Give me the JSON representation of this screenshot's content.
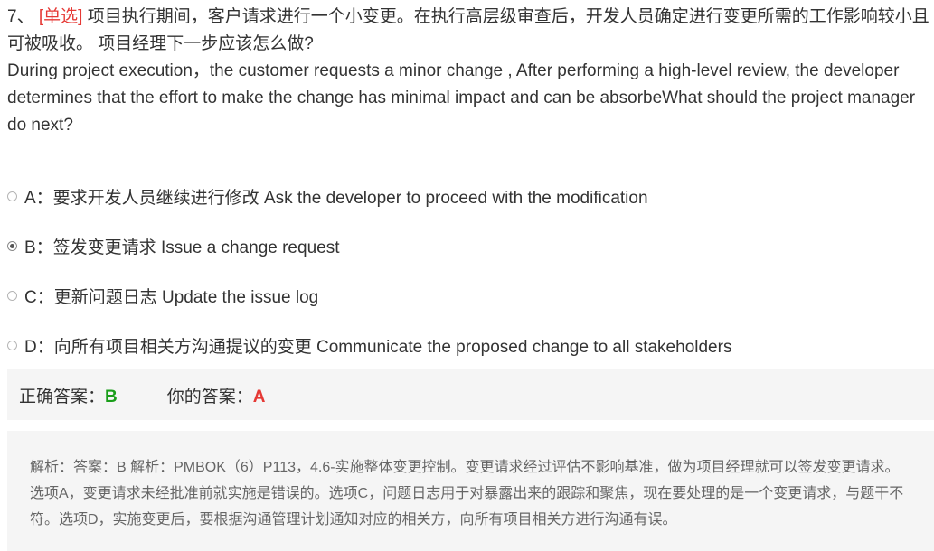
{
  "question": {
    "number": "7、",
    "type_tag": "[单选]",
    "text_cn": "项目执行期间，客户请求进行一个小变更。在执行高层级审查后，开发人员确定进行变更所需的工作影响较小且可被吸收。 项目经理下一步应该怎么做?",
    "text_en": "During project execution，the customer requests a minor change , After performing a high-level review, the developer determines that the effort to make the change has minimal impact and can be absorbeWhat should the project manager do next?"
  },
  "options": [
    {
      "label": "A：要求开发人员继续进行修改 Ask the developer to proceed with the modification",
      "selected": false
    },
    {
      "label": "B：签发变更请求 Issue a change request",
      "selected": true
    },
    {
      "label": "C：更新问题日志 Update the issue log",
      "selected": false
    },
    {
      "label": "D：向所有项目相关方沟通提议的变更 Communicate the proposed change to all stakeholders",
      "selected": false
    }
  ],
  "answer": {
    "correct_label": "正确答案：",
    "correct_value": "B",
    "your_label": "你的答案：",
    "your_value": "A"
  },
  "analysis": {
    "text": "解析：答案：B 解析：PMBOK（6）P113，4.6-实施整体变更控制。变更请求经过评估不影响基准，做为项目经理就可以签发变更请求。选项A，变更请求未经批准前就实施是错误的。选项C，问题日志用于对暴露出来的跟踪和聚焦，现在要处理的是一个变更请求，与题干不符。选项D，实施变更后，要根据沟通管理计划通知对应的相关方，向所有项目相关方进行沟通有误。"
  },
  "colors": {
    "tag": "#e53935",
    "correct": "#1a9e1a",
    "wrong": "#e53935",
    "panel_bg": "#f5f5f5"
  }
}
